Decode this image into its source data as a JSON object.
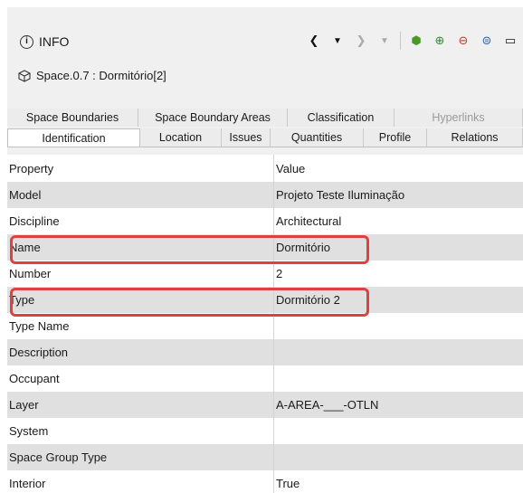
{
  "header": {
    "title": "INFO",
    "toolbar": [
      {
        "name": "back-icon",
        "glyph": "❮"
      },
      {
        "name": "back-dropdown-icon",
        "glyph": "▼"
      },
      {
        "name": "forward-icon",
        "glyph": "❯"
      },
      {
        "name": "forward-dropdown-icon",
        "glyph": "▼"
      },
      {
        "name": "objects-icon",
        "glyph": "⬢"
      },
      {
        "name": "expand-all-icon",
        "glyph": "⊕"
      },
      {
        "name": "collapse-all-icon",
        "glyph": "⊖"
      },
      {
        "name": "copy-icon",
        "glyph": "⊜"
      },
      {
        "name": "window-icon",
        "glyph": "▭"
      }
    ]
  },
  "subtitle": "Space.0.7 : Dormitório[2]",
  "tabs": {
    "back": [
      "Space Boundaries",
      "Space Boundary Areas",
      "Classification",
      "Hyperlinks"
    ],
    "front": [
      "Identification",
      "Location",
      "Issues",
      "Quantities",
      "Profile",
      "Relations"
    ],
    "active": "Identification"
  },
  "grid": {
    "header": {
      "property": "Property",
      "value": "Value"
    },
    "rows": [
      {
        "property": "Model",
        "value": "Projeto Teste Iluminação"
      },
      {
        "property": "Discipline",
        "value": "Architectural"
      },
      {
        "property": "Name",
        "value": "Dormitório"
      },
      {
        "property": "Number",
        "value": "2"
      },
      {
        "property": "Type",
        "value": "Dormitório 2"
      },
      {
        "property": "Type Name",
        "value": ""
      },
      {
        "property": "Description",
        "value": ""
      },
      {
        "property": "Occupant",
        "value": ""
      },
      {
        "property": "Layer",
        "value": "A-AREA-___-OTLN"
      },
      {
        "property": "System",
        "value": ""
      },
      {
        "property": "Space Group Type",
        "value": ""
      },
      {
        "property": "Interior",
        "value": "True"
      }
    ]
  },
  "colors": {
    "highlight": "#e04040",
    "alt_row": "#e0e0e0",
    "panel": "#f0f0f0"
  }
}
